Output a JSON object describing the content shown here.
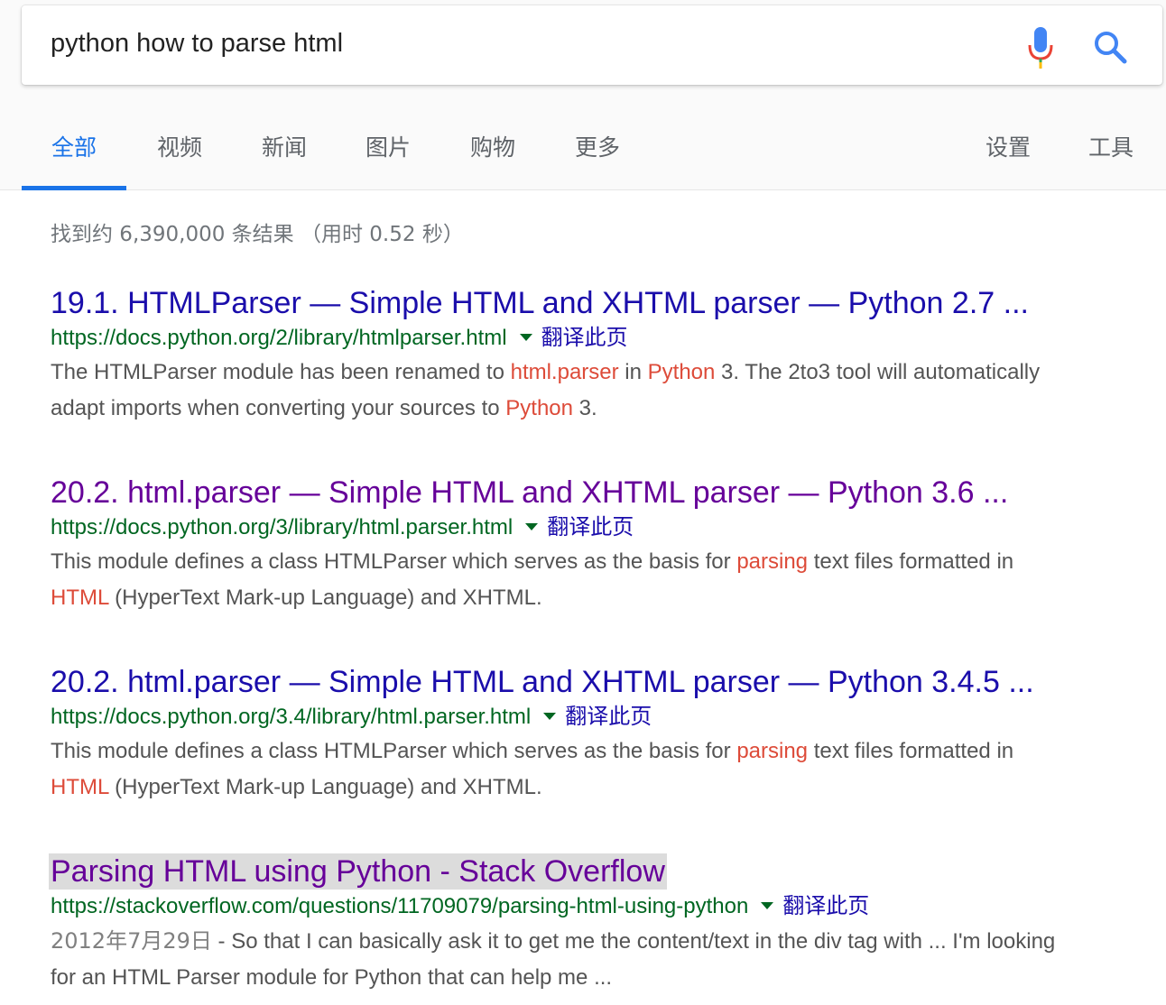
{
  "search": {
    "query": "python how to parse html"
  },
  "tabs": [
    {
      "label": "全部",
      "active": true
    },
    {
      "label": "视频"
    },
    {
      "label": "新闻"
    },
    {
      "label": "图片"
    },
    {
      "label": "购物"
    },
    {
      "label": "更多"
    },
    {
      "label": "设置"
    },
    {
      "label": "工具"
    }
  ],
  "stats": "找到约 6,390,000 条结果 （用时 0.52 秒）",
  "results": [
    {
      "title": "19.1. HTMLParser — Simple HTML and XHTML parser — Python 2.7 ...",
      "url": "https://docs.python.org/2/library/htmlparser.html",
      "translate": "翻译此页",
      "snippet": {
        "l1a": "The HTMLParser module has been renamed to ",
        "l1b": "html.parser",
        "l1c": " in ",
        "l1d": "Python",
        "l1e": " 3. The 2to3 tool will automatically",
        "l2a": "adapt imports when converting your sources to ",
        "l2b": "Python",
        "l2c": " 3."
      }
    },
    {
      "title": "20.2. html.parser — Simple HTML and XHTML parser — Python 3.6 ...",
      "url": "https://docs.python.org/3/library/html.parser.html",
      "translate": "翻译此页",
      "snippet": {
        "l1a": "This module defines a class HTMLParser which serves as the basis for ",
        "l1b": "parsing",
        "l1c": " text files formatted in",
        "l2a": "HTML",
        "l2b": " (HyperText Mark-up Language) and XHTML."
      }
    },
    {
      "title": "20.2. html.parser — Simple HTML and XHTML parser — Python 3.4.5 ...",
      "url": "https://docs.python.org/3.4/library/html.parser.html",
      "translate": "翻译此页",
      "snippet": {
        "l1a": "This module defines a class HTMLParser which serves as the basis for ",
        "l1b": "parsing",
        "l1c": " text files formatted in",
        "l2a": "HTML",
        "l2b": " (HyperText Mark-up Language) and XHTML."
      }
    },
    {
      "title": "Parsing HTML using Python - Stack Overflow",
      "url": "https://stackoverflow.com/questions/11709079/parsing-html-using-python",
      "translate": "翻译此页",
      "snippet": {
        "date": "2012年7月29日",
        "l1a": " - So that I can basically ask it to get me the content/text in the div tag with ... I'm looking",
        "l2a": "for an HTML Parser module for Python that can help me ..."
      }
    }
  ],
  "colors": {
    "link": "#1a0dab",
    "visited": "#660099",
    "url": "#006621",
    "emphasis": "#dd4b39",
    "tab_active": "#1a73e8"
  },
  "icons": [
    "microphone-icon",
    "search-icon",
    "dropdown-caret-icon"
  ]
}
